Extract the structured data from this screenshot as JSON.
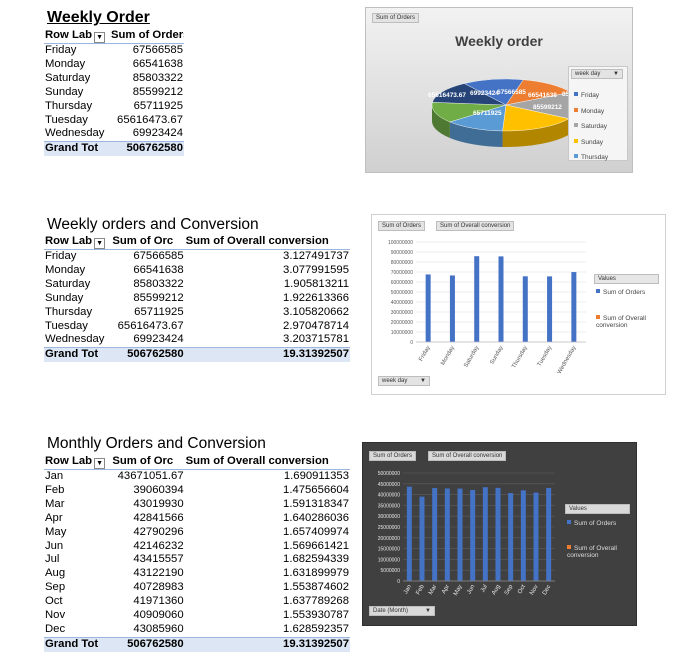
{
  "section1": {
    "title": "Weekly Order",
    "headers": [
      "Row Lab",
      "Sum of Orders"
    ],
    "rows": [
      [
        "Friday",
        "67566585"
      ],
      [
        "Monday",
        "66541638"
      ],
      [
        "Saturday",
        "85803322"
      ],
      [
        "Sunday",
        "85599212"
      ],
      [
        "Thursday",
        "65711925"
      ],
      [
        "Tuesday",
        "65616473.67"
      ],
      [
        "Wednesday",
        "69923424"
      ]
    ],
    "total": [
      "Grand Tot",
      "506762580"
    ],
    "chart": {
      "field_button": "Sum of Orders",
      "title": "Weekly order",
      "legend_button": "week day",
      "legend": [
        "Friday",
        "Monday",
        "Saturday",
        "Sunday",
        "Thursday"
      ],
      "labels": [
        "65616473.67",
        "69923424",
        "67566585",
        "66541638",
        "85803322",
        "85599212",
        "65711925"
      ]
    }
  },
  "section2": {
    "title": "Weekly orders and Conversion",
    "headers": [
      "Row Lab",
      "Sum of Orc",
      "Sum of Overall conversion"
    ],
    "rows": [
      [
        "Friday",
        "67566585",
        "3.127491737"
      ],
      [
        "Monday",
        "66541638",
        "3.077991595"
      ],
      [
        "Saturday",
        "85803322",
        "1.905813211"
      ],
      [
        "Sunday",
        "85599212",
        "1.922613366"
      ],
      [
        "Thursday",
        "65711925",
        "3.105820662"
      ],
      [
        "Tuesday",
        "65616473.67",
        "2.970478714"
      ],
      [
        "Wednesday",
        "69923424",
        "3.203715781"
      ]
    ],
    "total": [
      "Grand Tot",
      "506762580",
      "19.31392507"
    ],
    "chart": {
      "field_buttons": [
        "Sum of Orders",
        "Sum of Overall conversion"
      ],
      "legend_title": "Values",
      "legend": [
        "Sum of Orders",
        "Sum of Overall conversion"
      ],
      "axis_button": "week day",
      "y_ticks": [
        "100000000",
        "90000000",
        "80000000",
        "70000000",
        "60000000",
        "50000000",
        "40000000",
        "30000000",
        "20000000",
        "10000000",
        "0"
      ]
    }
  },
  "section3": {
    "title": "Monthly Orders and Conversion",
    "headers": [
      "Row Lab",
      "Sum of Orc",
      "Sum of Overall conversion"
    ],
    "rows": [
      [
        "Jan",
        "43671051.67",
        "1.690911353"
      ],
      [
        "Feb",
        "39060394",
        "1.475656604"
      ],
      [
        "Mar",
        "43019930",
        "1.591318347"
      ],
      [
        "Apr",
        "42841566",
        "1.640286036"
      ],
      [
        "May",
        "42790296",
        "1.657409974"
      ],
      [
        "Jun",
        "42146232",
        "1.569661421"
      ],
      [
        "Jul",
        "43415557",
        "1.682594339"
      ],
      [
        "Aug",
        "43122190",
        "1.631899979"
      ],
      [
        "Sep",
        "40728983",
        "1.553874602"
      ],
      [
        "Oct",
        "41971360",
        "1.637789268"
      ],
      [
        "Nov",
        "40909060",
        "1.553930787"
      ],
      [
        "Dec",
        "43085960",
        "1.628592357"
      ]
    ],
    "total": [
      "Grand Tot",
      "506762580",
      "19.31392507"
    ],
    "chart": {
      "field_buttons": [
        "Sum of Orders",
        "Sum of Overall conversion"
      ],
      "legend_title": "Values",
      "legend": [
        "Sum of Orders",
        "Sum of Overall conversion"
      ],
      "axis_button": "Date (Month)",
      "y_ticks": [
        "50000000",
        "45000000",
        "40000000",
        "35000000",
        "30000000",
        "25000000",
        "20000000",
        "15000000",
        "10000000",
        "5000000",
        "0"
      ]
    }
  },
  "chart_data": [
    {
      "type": "pie",
      "title": "Weekly order",
      "categories": [
        "Friday",
        "Monday",
        "Saturday",
        "Sunday",
        "Thursday",
        "Tuesday",
        "Wednesday"
      ],
      "values": [
        67566585,
        66541638,
        85803322,
        85599212,
        65711925,
        65616473.67,
        69923424
      ],
      "colors": [
        "#4472c4",
        "#ed7d31",
        "#a5a5a5",
        "#ffc000",
        "#5b9bd5",
        "#70ad47",
        "#264478"
      ]
    },
    {
      "type": "bar",
      "categories": [
        "Friday",
        "Monday",
        "Saturday",
        "Sunday",
        "Thursday",
        "Tuesday",
        "Wednesday"
      ],
      "series": [
        {
          "name": "Sum of Orders",
          "values": [
            67566585,
            66541638,
            85803322,
            85599212,
            65711925,
            65616473.67,
            69923424
          ],
          "color": "#4472c4"
        },
        {
          "name": "Sum of Overall conversion",
          "values": [
            3.127491737,
            3.077991595,
            1.905813211,
            1.922613366,
            3.105820662,
            2.970478714,
            3.203715781
          ],
          "color": "#ed7d31"
        }
      ],
      "ylim": [
        0,
        100000000
      ],
      "grid": true,
      "legend": "right"
    },
    {
      "type": "bar",
      "categories": [
        "Jan",
        "Feb",
        "Mar",
        "Apr",
        "May",
        "Jun",
        "Jul",
        "Aug",
        "Sep",
        "Oct",
        "Nov",
        "Dec"
      ],
      "series": [
        {
          "name": "Sum of Orders",
          "values": [
            43671051.67,
            39060394,
            43019930,
            42841566,
            42790296,
            42146232,
            43415557,
            43122190,
            40728983,
            41971360,
            40909060,
            43085960
          ],
          "color": "#4472c4"
        },
        {
          "name": "Sum of Overall conversion",
          "values": [
            1.690911353,
            1.475656604,
            1.591318347,
            1.640286036,
            1.657409974,
            1.569661421,
            1.682594339,
            1.631899979,
            1.553874602,
            1.637789268,
            1.553930787,
            1.628592357
          ],
          "color": "#ed7d31"
        }
      ],
      "ylim": [
        0,
        50000000
      ],
      "grid": true,
      "legend": "right",
      "background": "#404040"
    }
  ]
}
